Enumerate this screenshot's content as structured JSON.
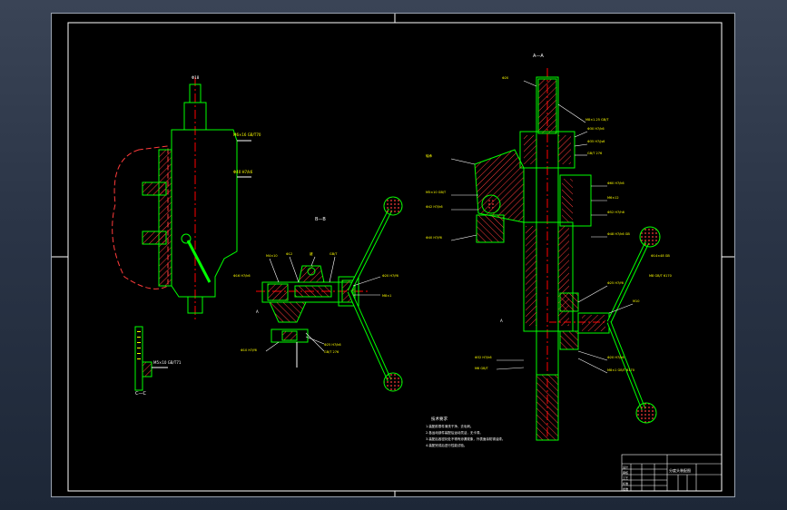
{
  "sheet": {
    "view_labels": {
      "section_a": "A—A",
      "section_b": "B—B",
      "section_c": "C—C",
      "marker_a_left": "A",
      "marker_a_right": "A"
    },
    "tech_requirements_title": "技术要求",
    "tech_requirements": [
      "1.装配前零件清洗干净，去毛刺。",
      "2.各运动部件装配后运动灵活，无卡滞。",
      "3.装配后各密封处不得有渗漏现象，外表面涂防锈油漆。",
      "4.装配完成后进行性能试验。"
    ],
    "title_block": {
      "name_cell": "分度头装配图",
      "rows": [
        "设计",
        "审核",
        "工艺",
        "标准",
        "批准"
      ]
    }
  },
  "colors": {
    "background": "#000000",
    "frame": "#ffffff",
    "outline": "#00ff00",
    "centerline": "#ff0000",
    "hatch": "#ff3b3b",
    "dims": "#ffffff",
    "labels": "#ffff00",
    "hidden": "#00ffff"
  }
}
